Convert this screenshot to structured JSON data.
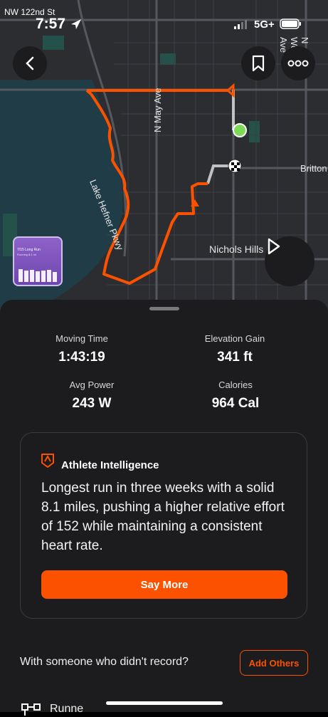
{
  "status_bar": {
    "street": "NW 122nd St",
    "time": "7:57",
    "network": "5G+"
  },
  "map": {
    "labels": {
      "lake_parkway": "Lake Hefner Pkwy",
      "may_ave": "N May Ave",
      "western_ave": "N Western Ave",
      "britton": "Britton",
      "nichols_hills": "Nichols Hills"
    },
    "route_color": "#fc5200",
    "thumbnail": {
      "title": "7/15 Long Run",
      "subtitle": "Running 8.1 mi"
    }
  },
  "stats": {
    "moving_time": {
      "label": "Moving Time",
      "value": "1:43:19"
    },
    "elevation_gain": {
      "label": "Elevation Gain",
      "value": "341 ft"
    },
    "avg_power": {
      "label": "Avg Power",
      "value": "243 W"
    },
    "calories": {
      "label": "Calories",
      "value": "964 Cal"
    }
  },
  "athlete_intelligence": {
    "title": "Athlete Intelligence",
    "body": "Longest run in three weeks with a solid 8.1 miles, pushing a higher relative effort of 152 while maintaining a consistent heart rate.",
    "button": "Say More"
  },
  "others": {
    "prompt": "With someone who didn't record?",
    "button": "Add Others"
  },
  "sport_type": {
    "label": "Runne"
  },
  "colors": {
    "accent": "#fc5200",
    "sheet": "#1c1c1e",
    "start": "#7ed957"
  }
}
